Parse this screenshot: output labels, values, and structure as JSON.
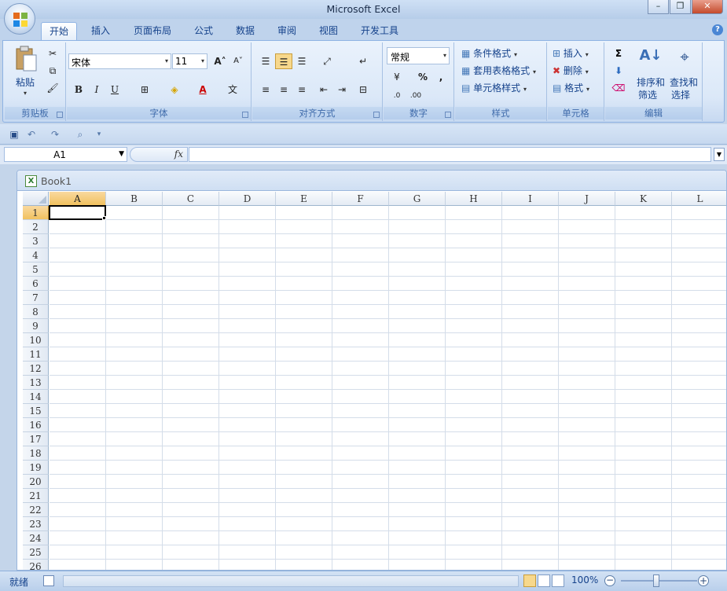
{
  "window": {
    "title": "Microsoft Excel"
  },
  "tabs": [
    "开始",
    "插入",
    "页面布局",
    "公式",
    "数据",
    "审阅",
    "视图",
    "开发工具"
  ],
  "ribbon": {
    "clipboard": {
      "label": "剪贴板",
      "paste": "粘贴"
    },
    "font": {
      "label": "字体",
      "font_name": "宋体",
      "font_size": "11",
      "bold": "B",
      "italic": "I",
      "underline": "U"
    },
    "alignment": {
      "label": "对齐方式"
    },
    "number": {
      "label": "数字",
      "format": "常规",
      "percent": "%",
      "comma": ","
    },
    "styles": {
      "label": "样式",
      "conditional": "条件格式",
      "table_format": "套用表格格式",
      "cell_styles": "单元格样式"
    },
    "cells": {
      "label": "单元格",
      "insert": "插入",
      "delete": "删除",
      "format": "格式"
    },
    "editing": {
      "label": "编辑",
      "sort_filter_1": "排序和",
      "sort_filter_2": "筛选",
      "find_select_1": "查找和",
      "find_select_2": "选择"
    }
  },
  "formula_bar": {
    "name_box": "A1",
    "fx": "fx",
    "value": ""
  },
  "workbook": {
    "title": "Book1"
  },
  "columns": [
    "A",
    "B",
    "C",
    "D",
    "E",
    "F",
    "G",
    "H",
    "I",
    "J",
    "K",
    "L"
  ],
  "rows": [
    "1",
    "2",
    "3",
    "4",
    "5",
    "6",
    "7",
    "8",
    "9",
    "10",
    "11",
    "12",
    "13",
    "14",
    "15",
    "16",
    "17",
    "18",
    "19",
    "20",
    "21",
    "22",
    "23",
    "24",
    "25",
    "26"
  ],
  "selected_cell": {
    "column": "A",
    "row": "1"
  },
  "status_bar": {
    "status": "就绪",
    "zoom": "100%"
  },
  "colors": {
    "accent": "#15428b",
    "selected_header": "#f1c15f"
  }
}
